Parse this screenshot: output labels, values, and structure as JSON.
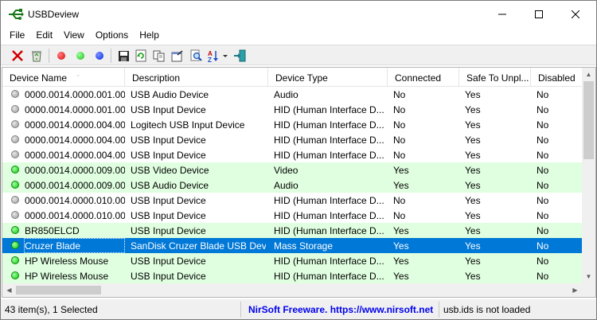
{
  "window": {
    "title": "USBDeview"
  },
  "menu": [
    "File",
    "Edit",
    "View",
    "Options",
    "Help"
  ],
  "toolbar": {
    "colors": {
      "red": "#e00000",
      "green": "#10c010",
      "blue": "#0030e0"
    }
  },
  "columns": [
    "Device Name",
    "Description",
    "Device Type",
    "Connected",
    "Safe To Unpl...",
    "Disabled"
  ],
  "rows": [
    {
      "status": "gray",
      "name": "0000.0014.0000.001.00...",
      "description": "USB Audio Device",
      "type": "Audio",
      "connected": "No",
      "safe": "Yes",
      "disabled": "No"
    },
    {
      "status": "gray",
      "name": "0000.0014.0000.001.00...",
      "description": "USB Input Device",
      "type": "HID (Human Interface D...",
      "connected": "No",
      "safe": "Yes",
      "disabled": "No"
    },
    {
      "status": "gray",
      "name": "0000.0014.0000.004.00...",
      "description": "Logitech USB Input Device",
      "type": "HID (Human Interface D...",
      "connected": "No",
      "safe": "Yes",
      "disabled": "No"
    },
    {
      "status": "gray",
      "name": "0000.0014.0000.004.00...",
      "description": "USB Input Device",
      "type": "HID (Human Interface D...",
      "connected": "No",
      "safe": "Yes",
      "disabled": "No"
    },
    {
      "status": "gray",
      "name": "0000.0014.0000.004.00...",
      "description": "USB Input Device",
      "type": "HID (Human Interface D...",
      "connected": "No",
      "safe": "Yes",
      "disabled": "No"
    },
    {
      "status": "green",
      "name": "0000.0014.0000.009.00...",
      "description": "USB Video Device",
      "type": "Video",
      "connected": "Yes",
      "safe": "Yes",
      "disabled": "No"
    },
    {
      "status": "green",
      "name": "0000.0014.0000.009.00...",
      "description": "USB Audio Device",
      "type": "Audio",
      "connected": "Yes",
      "safe": "Yes",
      "disabled": "No"
    },
    {
      "status": "gray",
      "name": "0000.0014.0000.010.00...",
      "description": "USB Input Device",
      "type": "HID (Human Interface D...",
      "connected": "No",
      "safe": "Yes",
      "disabled": "No"
    },
    {
      "status": "gray",
      "name": "0000.0014.0000.010.00...",
      "description": "USB Input Device",
      "type": "HID (Human Interface D...",
      "connected": "No",
      "safe": "Yes",
      "disabled": "No"
    },
    {
      "status": "green",
      "name": "BR850ELCD",
      "description": "USB Input Device",
      "type": "HID (Human Interface D...",
      "connected": "Yes",
      "safe": "Yes",
      "disabled": "No"
    },
    {
      "status": "green",
      "name": "Cruzer Blade",
      "description": "SanDisk Cruzer Blade USB Dev...",
      "type": "Mass Storage",
      "connected": "Yes",
      "safe": "Yes",
      "disabled": "No",
      "selected": true
    },
    {
      "status": "green",
      "name": "HP Wireless Mouse",
      "description": "USB Input Device",
      "type": "HID (Human Interface D...",
      "connected": "Yes",
      "safe": "Yes",
      "disabled": "No"
    },
    {
      "status": "green",
      "name": "HP Wireless Mouse",
      "description": "USB Input Device",
      "type": "HID (Human Interface D...",
      "connected": "Yes",
      "safe": "Yes",
      "disabled": "No"
    }
  ],
  "status": {
    "count": "43 item(s), 1 Selected",
    "nirsoft": "NirSoft Freeware.  https://www.nirsoft.net",
    "usbids": "usb.ids is not loaded"
  }
}
